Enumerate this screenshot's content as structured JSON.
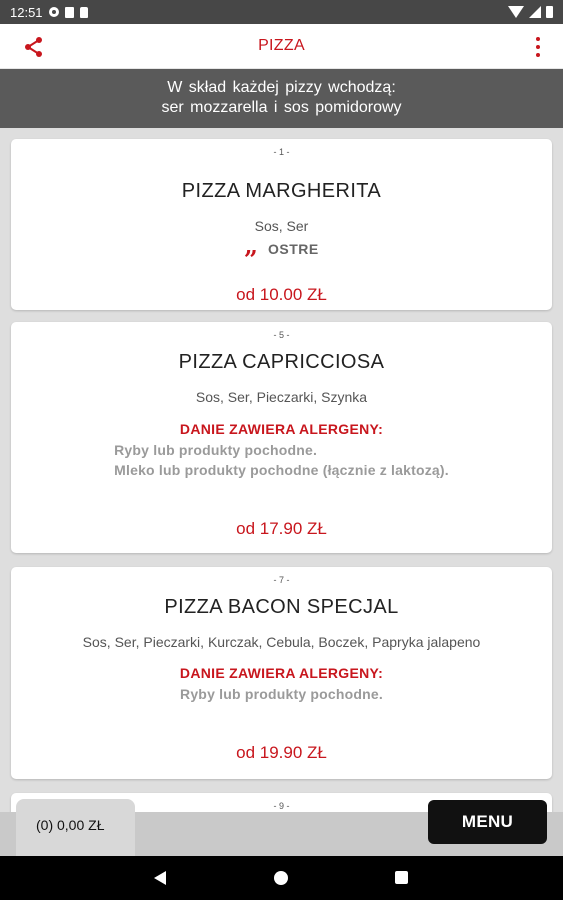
{
  "status_bar": {
    "time": "12:51"
  },
  "app_bar": {
    "title": "PIZZA",
    "share_icon": "share-icon",
    "more_icon": "more-vert-icon"
  },
  "banner": {
    "line1": "W skład każdej pizzy wchodzą:",
    "line2": "ser mozzarella i sos pomidorowy"
  },
  "colors": {
    "accent": "#c8161d",
    "banner_bg": "#5a5a5a",
    "status_bg": "#474747",
    "menu_button_bg": "#111111"
  },
  "items": [
    {
      "number": "- 1 -",
      "name": "PIZZA MARGHERITA",
      "ingredients": "Sos, Ser",
      "hot_icon": "„",
      "hot_label": "OSTRE",
      "price": "od 10.00 ZŁ"
    },
    {
      "number": "- 5 -",
      "name": "PIZZA CAPRICCIOSA",
      "ingredients": "Sos, Ser, Pieczarki, Szynka",
      "allergen_title": "DANIE ZAWIERA ALERGENY:",
      "allergens": [
        "Ryby lub produkty pochodne.",
        "Mleko lub produkty pochodne (łącznie z laktozą)."
      ],
      "price": "od 17.90 ZŁ"
    },
    {
      "number": "- 7 -",
      "name": "PIZZA BACON SPECJAL",
      "ingredients": "Sos, Ser, Pieczarki, Kurczak, Cebula, Boczek, Papryka jalapeno",
      "allergen_title": "DANIE ZAWIERA ALERGENY:",
      "allergens": [
        "Ryby lub produkty pochodne."
      ],
      "price": "od 19.90 ZŁ"
    },
    {
      "number": "- 9 -"
    }
  ],
  "cart": {
    "label": "(0) 0,00 ZŁ"
  },
  "menu_button": {
    "label": "MENU"
  }
}
